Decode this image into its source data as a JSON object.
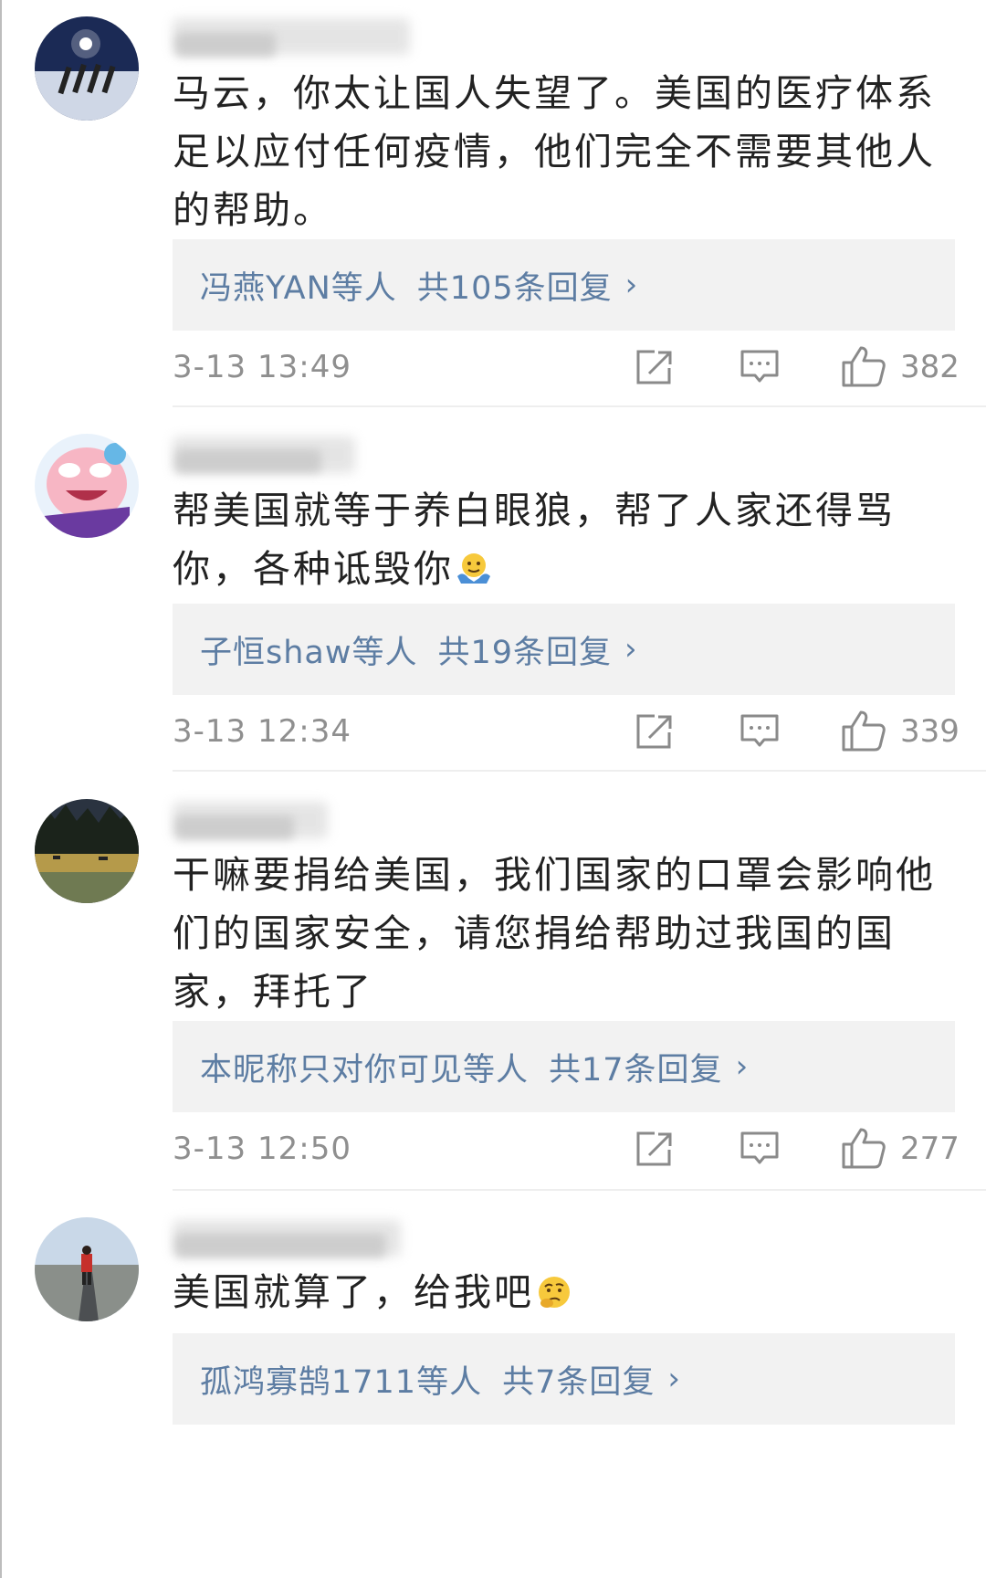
{
  "comments": [
    {
      "text": "马云，你太让国人失望了。美国的医疗体系足以应付任何疫情，他们完全不需要其他人的帮助。",
      "reply_who": "冯燕YAN等人",
      "reply_count": "共105条回复",
      "time": "3-13 13:49",
      "likes": "382"
    },
    {
      "text": "帮美国就等于养白眼狼，帮了人家还得骂你，各种诋毁你",
      "reply_who": "子恒shaw等人",
      "reply_count": "共19条回复",
      "time": "3-13 12:34",
      "likes": "339"
    },
    {
      "text": "干嘛要捐给美国，我们国家的口罩会影响他们的国家安全，请您捐给帮助过我国的国家，拜托了",
      "reply_who": "本昵称只对你可见等人",
      "reply_count": "共17条回复",
      "time": "3-13 12:50",
      "likes": "277"
    },
    {
      "text": "美国就算了，给我吧",
      "reply_who": "孤鸿寡鹄1711等人",
      "reply_count": "共7条回复"
    }
  ],
  "icons": {
    "share": "share-icon",
    "reply": "comment-icon",
    "like": "thumbs-up-icon",
    "chevron": "chevron-right-icon",
    "emoji_shrug": "shrug-emoji-icon",
    "emoji_think": "thinking-emoji-icon"
  },
  "colors": {
    "link": "#5d7da3",
    "text": "#222222",
    "meta": "#8f8f8f",
    "reply_bg": "#f2f2f2"
  },
  "chevron_glyph": "›"
}
